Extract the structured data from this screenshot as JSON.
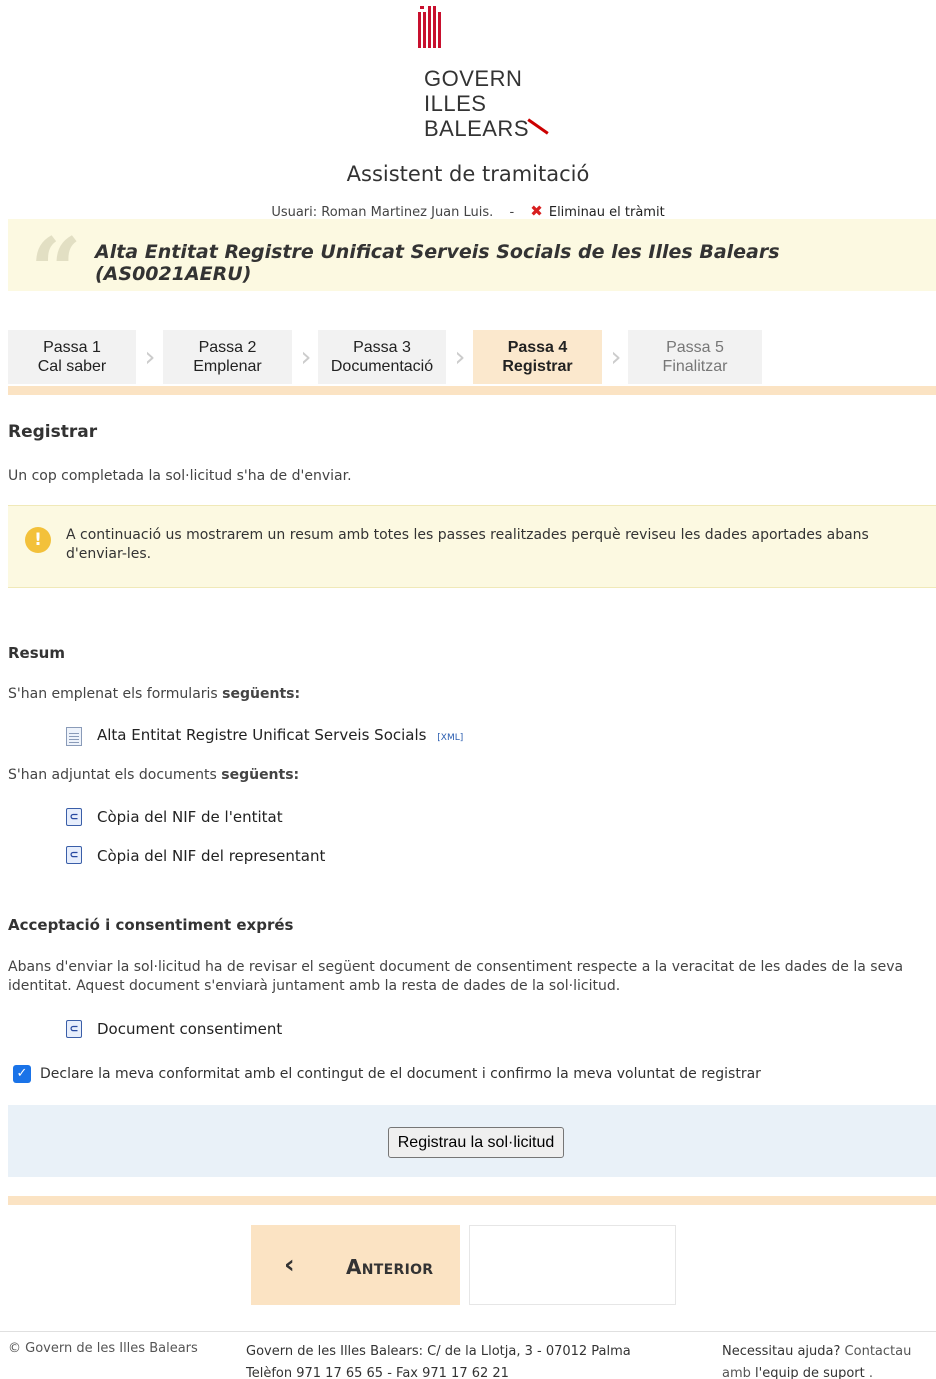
{
  "header": {
    "logo_lines": [
      "GOVERN",
      "ILLES",
      "BALEARS"
    ],
    "app_title": "Assistent de tramitació",
    "user_label": "Usuari: Roman Martinez Juan Luis.",
    "separator": "-",
    "delete_label": "Eliminau el tràmit",
    "procedure_title": "Alta Entitat Registre Unificat Serveis Socials de les Illes Balears (AS0021AERU)"
  },
  "steps": [
    {
      "num": "Passa 1",
      "label": "Cal saber",
      "state": "done"
    },
    {
      "num": "Passa 2",
      "label": "Emplenar",
      "state": "done"
    },
    {
      "num": "Passa 3",
      "label": "Documentació",
      "state": "done"
    },
    {
      "num": "Passa 4",
      "label": "Registrar",
      "state": "active"
    },
    {
      "num": "Passa 5",
      "label": "Finalitzar",
      "state": "disabled"
    }
  ],
  "register": {
    "title": "Registrar",
    "intro": "Un cop completada la sol·licitud s'ha de d'enviar.",
    "alert_icon": "!",
    "alert_text": "A continuació us mostrarem un resum amb totes les passes realitzades perquè reviseu les dades aportades abans d'enviar-les."
  },
  "summary": {
    "title": "Resum",
    "forms_intro": "S'han emplenat els formularis",
    "forms_intro_bold": "següents:",
    "forms": [
      {
        "label": "Alta Entitat Registre Unificat Serveis Socials",
        "tag": "[XML]"
      }
    ],
    "docs_intro": "S'han adjuntat els documents",
    "docs_intro_bold": "següents:",
    "documents": [
      "Còpia del NIF de l'entitat",
      "Còpia del NIF del representant"
    ]
  },
  "consent": {
    "title": "Acceptació i consentiment exprés",
    "text": "Abans d'enviar la sol·licitud ha de revisar el següent document de consentiment respecte a la veracitat de les dades de la seva identitat. Aquest document s'enviarà juntament amb la resta de dades de la sol·licitud.",
    "document": "Document consentiment",
    "checkbox_label": "Declare la meva conformitat amb el contingut de el document i confirmo la meva voluntat de registrar",
    "checked": true
  },
  "actions": {
    "submit_label": "Registrau la sol·licitud",
    "prev_chevron": "‹",
    "prev_label": "Anterior"
  },
  "footer": {
    "copyright": "© Govern de les Illes Balears",
    "address_line1": "Govern de les Illes Balears: C/ de la Llotja, 3 - 07012 Palma",
    "address_line2": "Telèfon 971 17 65 65 - Fax 971 17 62 21",
    "help_bold": "Necessitau ajuda?",
    "help_text": "Contactau amb",
    "help_link": "l'equip de suport",
    "help_end": "."
  },
  "colors": {
    "banner_bg": "#fcf9e1",
    "step_active_bg": "#fbe8cd",
    "panel_bg": "#e9f1f8",
    "accent_orange": "#fbe3c3",
    "checkbox_blue": "#1a73e8"
  }
}
